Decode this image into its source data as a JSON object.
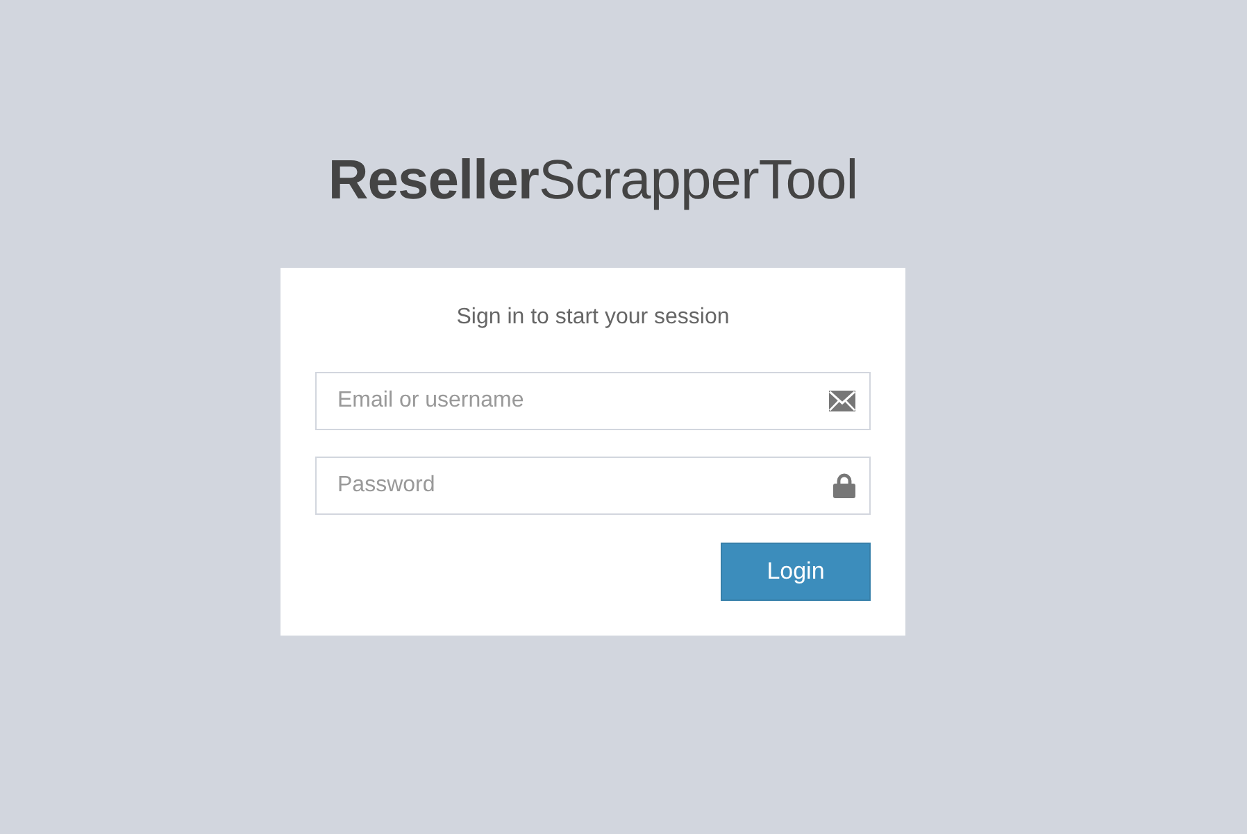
{
  "logo": {
    "text": "**Reseller**ScrapperTool"
  },
  "login_box": {
    "message": "Sign in to start your session",
    "fields": [
      {
        "kind": "email",
        "placeholder": "Email or username"
      },
      {
        "kind": "password",
        "placeholder": "Password"
      }
    ],
    "button": {
      "label": "Login"
    }
  }
}
